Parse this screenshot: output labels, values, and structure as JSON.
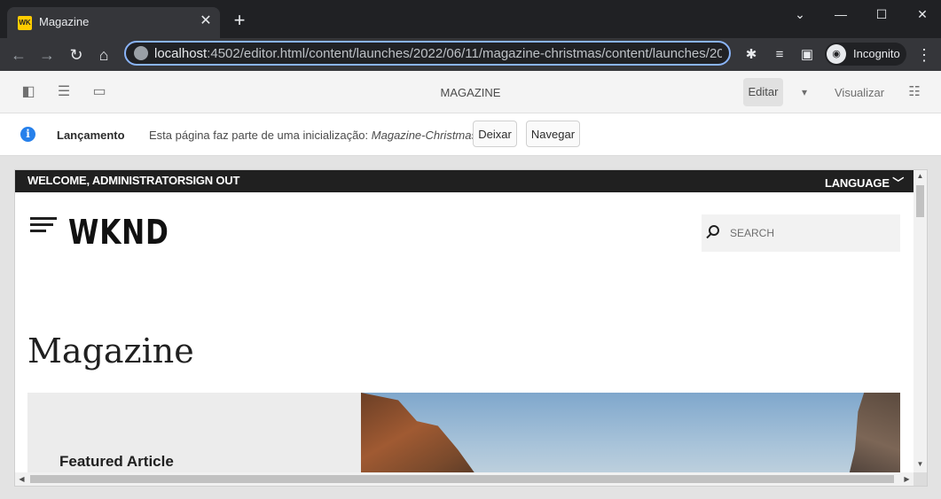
{
  "browser": {
    "tab_title": "Magazine",
    "tab_favicon_text": "WK",
    "url_host": "localhost",
    "url_rest": ":4502/editor.html/content/launches/2022/06/11/magazine-christmas/content/launches/2022/0",
    "profile_label": "Incognito"
  },
  "editor": {
    "page_title": "MAGAZINE",
    "edit_label": "Editar",
    "view_label": "Visualizar"
  },
  "launch": {
    "title": "Lançamento",
    "message": "Esta página faz parte de uma inicialização:",
    "launch_name": "Magazine-Christmas",
    "leave_label": "Deixar",
    "navigate_label": "Navegar"
  },
  "site": {
    "welcome": "WELCOME, ADMINISTRATOR",
    "sign_out": "SIGN OUT",
    "language": "LANGUAGE",
    "logo": "WKND",
    "search_placeholder": "SEARCH",
    "heading": "Magazine",
    "featured_label": "Featured Article"
  },
  "colors": {
    "omnibox_focus": "#8ab4f8",
    "info_blue": "#2680eb",
    "wknd_yellow": "#ffcc00"
  }
}
